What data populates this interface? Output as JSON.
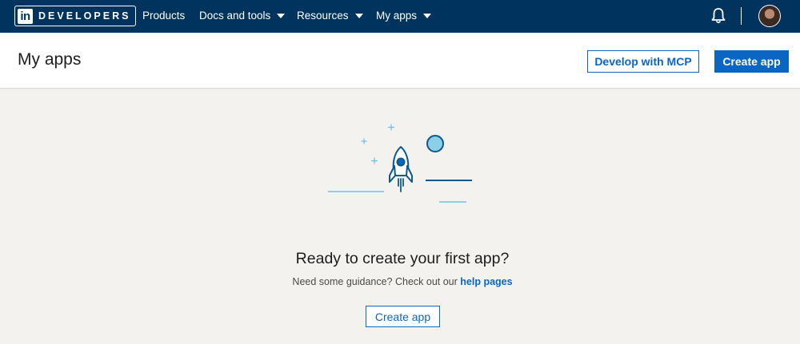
{
  "nav": {
    "logo_in": "in",
    "logo_text": "DEVELOPERS",
    "items": [
      {
        "label": "Products"
      },
      {
        "label": "Docs and tools"
      },
      {
        "label": "Resources"
      },
      {
        "label": "My apps"
      }
    ],
    "notifications_icon": "bell-icon"
  },
  "header": {
    "title": "My apps",
    "develop_mcp_label": "Develop with MCP",
    "create_app_label": "Create app"
  },
  "empty_state": {
    "illustration_icon": "rocket-icon",
    "heading": "Ready to create your first app?",
    "guidance_text": "Need some guidance? Check out our ",
    "help_link": "help pages",
    "create_app_label": "Create app"
  },
  "colors": {
    "nav_bg": "#00345f",
    "accent": "#0a66c2",
    "page_bg": "#f3f2ef"
  }
}
